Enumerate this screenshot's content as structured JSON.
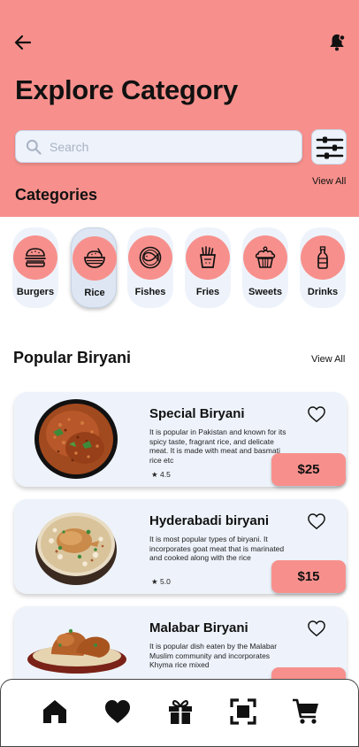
{
  "header": {
    "title": "Explore Category",
    "back_icon": "arrow-left-icon",
    "notification_icon": "bell-icon"
  },
  "search": {
    "placeholder": "Search",
    "value": "",
    "icon": "search-icon",
    "filter_icon": "sliders-icon"
  },
  "categories": {
    "title": "Categories",
    "view_all": "View All",
    "items": [
      {
        "label": "Burgers",
        "icon": "burger-icon",
        "selected": false
      },
      {
        "label": "Rice",
        "icon": "rice-bowl-icon",
        "selected": true
      },
      {
        "label": "Fishes",
        "icon": "fish-plate-icon",
        "selected": false
      },
      {
        "label": "Fries",
        "icon": "fries-icon",
        "selected": false
      },
      {
        "label": "Sweets",
        "icon": "cupcake-icon",
        "selected": false
      },
      {
        "label": "Drinks",
        "icon": "bottle-icon",
        "selected": false
      }
    ]
  },
  "popular": {
    "title": "Popular Biryani",
    "view_all": "View All",
    "items": [
      {
        "name": "Special Biryani",
        "description": "It is popular in Pakistan and known for its spicy taste, fragrant rice, and delicate meat. It is made with meat and basmati rice etc",
        "rating": "4.5",
        "price": "$25",
        "favorite": false
      },
      {
        "name": "Hyderabadi biryani",
        "description": "It is most popular types of biryani. It incorporates goat meat that is marinated and cooked along with the rice",
        "rating": "5.0",
        "price": "$15",
        "favorite": false
      },
      {
        "name": "Malabar Biryani",
        "description": "It is popular dish eaten by the Malabar Muslim community and incorporates Khyma rice mixed",
        "rating": "",
        "price": "",
        "favorite": false
      }
    ]
  },
  "bottom_nav": {
    "items": [
      {
        "icon": "home-icon",
        "active": true
      },
      {
        "icon": "heart-icon",
        "active": false
      },
      {
        "icon": "gift-icon",
        "active": false
      },
      {
        "icon": "scan-icon",
        "active": false
      },
      {
        "icon": "cart-icon",
        "active": false
      }
    ]
  },
  "colors": {
    "accent": "#f7908c",
    "card_background": "#eef3fb",
    "text": "#111111"
  }
}
